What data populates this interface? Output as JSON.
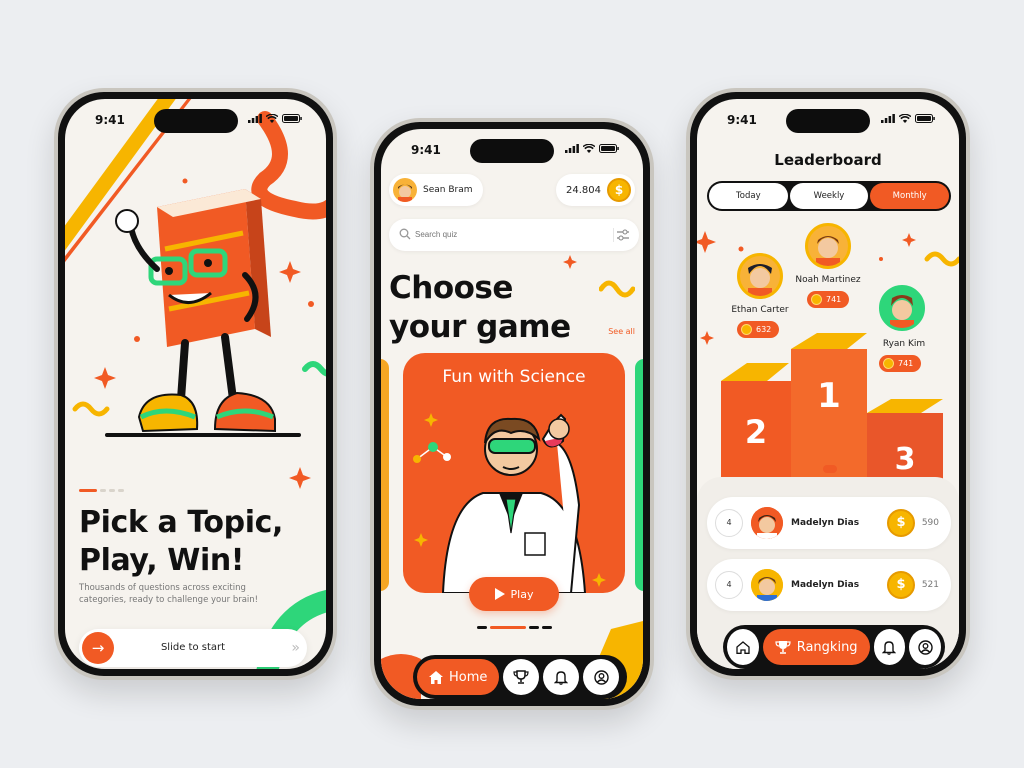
{
  "status_time": "9:41",
  "phone1": {
    "headline_line1": "Pick a Topic,",
    "headline_line2": "Play, Win!",
    "subtitle": "Thousands of questions across exciting categories, ready to challenge your brain!",
    "slide_label": "Slide to start",
    "slide_arrow": "→",
    "slide_chevrons": "»"
  },
  "phone2": {
    "user_name": "Sean Bram",
    "coins": "24.804",
    "coin_symbol": "$",
    "search_placeholder": "Search quiz",
    "headline_line1": "Choose",
    "headline_line2": "your game",
    "see_all": "See all",
    "card_title": "Fun with Science",
    "play_label": "Play",
    "nav_home": "Home"
  },
  "phone3": {
    "title": "Leaderboard",
    "tabs": [
      {
        "label": "Today"
      },
      {
        "label": "Weekly"
      },
      {
        "label": "Monthly"
      }
    ],
    "podium": [
      {
        "rank": "1",
        "name": "Noah Martinez",
        "score": "741"
      },
      {
        "rank": "2",
        "name": "Ethan Carter",
        "score": "632"
      },
      {
        "rank": "3",
        "name": "Ryan Kim",
        "score": "741"
      }
    ],
    "rows": [
      {
        "rank": "4",
        "name": "Madelyn Dias",
        "score": "590"
      },
      {
        "rank": "4",
        "name": "Madelyn Dias",
        "score": "521"
      }
    ],
    "coin_symbol": "$",
    "nav_active": "Rangking"
  },
  "colors": {
    "accent": "#f15a24",
    "gold": "#f7b500",
    "green": "#2ed67a",
    "dark": "#111111",
    "cream": "#f6f3ee"
  }
}
